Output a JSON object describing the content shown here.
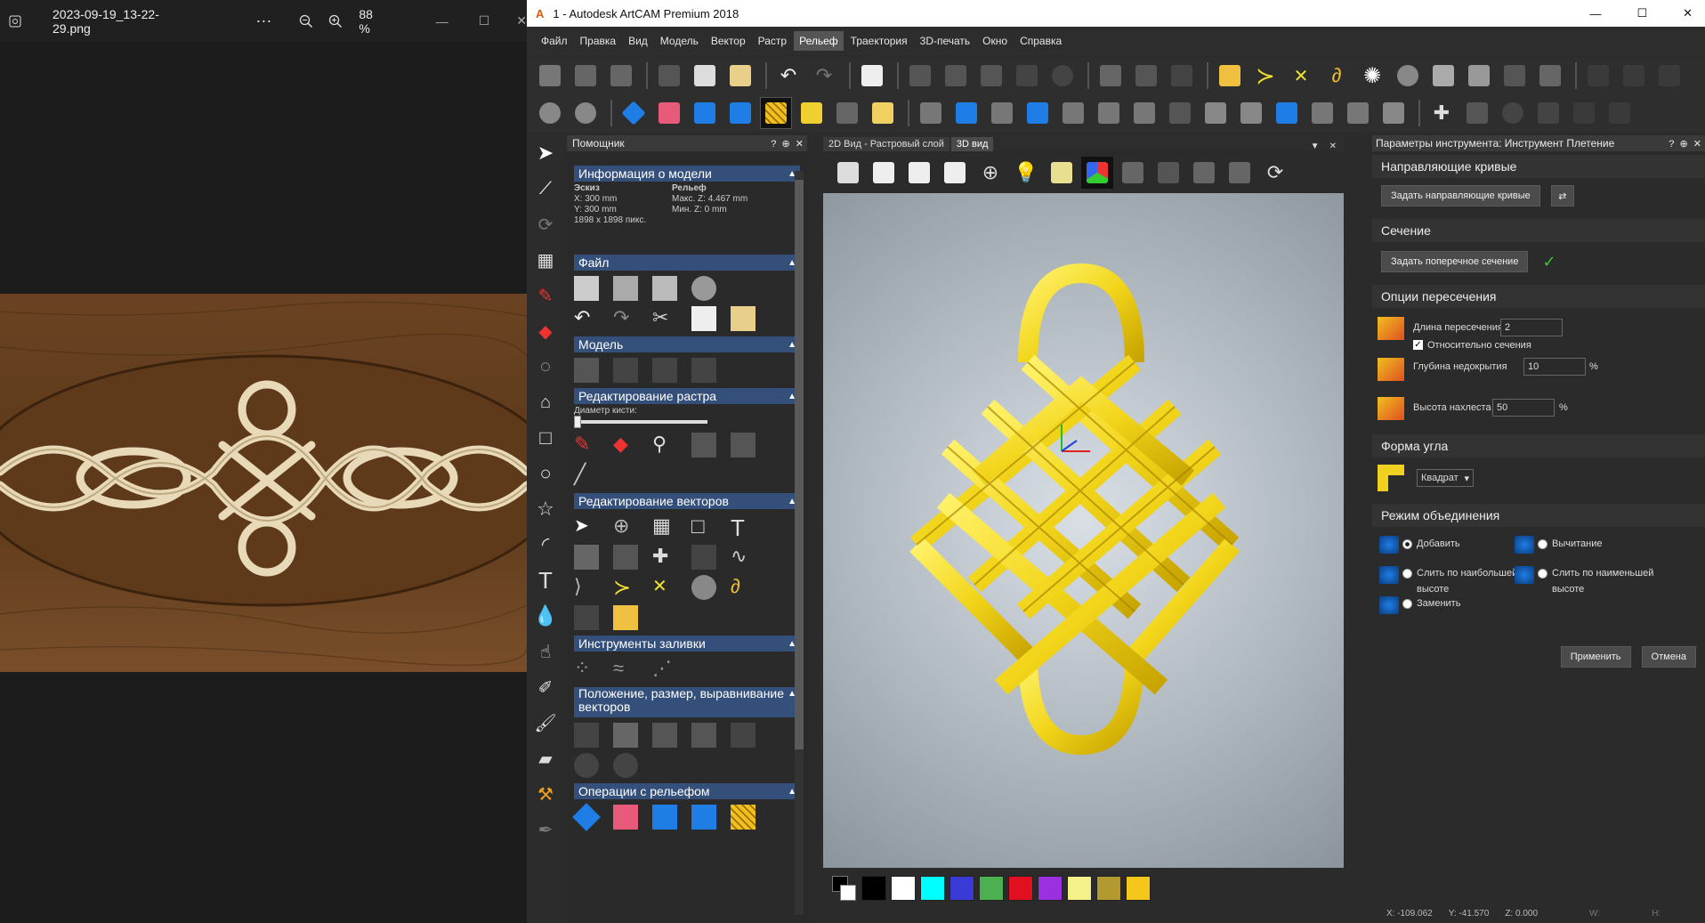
{
  "viewer": {
    "filename": "2023-09-19_13-22-29.png",
    "more": "···",
    "zoom": "88 %"
  },
  "app": {
    "title": "1 - Autodesk ArtCAM Premium 2018"
  },
  "menu": [
    "Файл",
    "Правка",
    "Вид",
    "Модель",
    "Вектор",
    "Растр",
    "Рельеф",
    "Траектория",
    "3D-печать",
    "Окно",
    "Справка"
  ],
  "wizard": {
    "title": "Помощник",
    "model_info": {
      "header": "Информация о модели",
      "sketch_label": "Эскиз",
      "x": "X: 300 mm",
      "y": "Y: 300 mm",
      "pixels": "1898 x 1898 пикс.",
      "relief_label": "Рельеф",
      "max_z": "Макс. Z: 4.467 mm",
      "min_z": "Мин. Z: 0 mm"
    },
    "file_header": "Файл",
    "model_header": "Модель",
    "raster_header": "Редактирование растра",
    "brush_label": "Диаметр кисти:",
    "vector_header": "Редактирование векторов",
    "fill_header": "Инструменты заливки",
    "position_header": "Положение, размер, выравнивание векторов",
    "relief_header": "Операции с рельефом"
  },
  "tabs": {
    "tab2d": "2D Вид - Растровый слой",
    "tab3d": "3D вид"
  },
  "palette": [
    "#000000",
    "#ffffff",
    "#00ffff",
    "#3a3ad6",
    "#4caf50",
    "#e01020",
    "#9b30e0",
    "#f5f18a",
    "#b29a30",
    "#f5c71a"
  ],
  "toolparams": {
    "title": "Параметры инструмента: Инструмент Плетение",
    "guides_header": "Направляющие кривые",
    "guides_button": "Задать направляющие кривые",
    "section_header": "Сечение",
    "section_button": "Задать поперечное сечение",
    "intersect_header": "Опции пересечения",
    "intersect_len_label": "Длина пересечения",
    "intersect_len_value": "2",
    "relative_label": "Относительно сечения",
    "undercover_label": "Глубина недокрытия",
    "undercover_value": "10",
    "overlap_label": "Высота нахлеста",
    "overlap_value": "50",
    "percent": "%",
    "corner_header": "Форма угла",
    "corner_value": "Квадрат",
    "merge_header": "Режим объединения",
    "add": "Добавить",
    "subtract": "Вычитание",
    "merge_high_1": "Слить по наибольшей",
    "merge_high_2": "высоте",
    "merge_low_1": "Слить по наименьшей",
    "merge_low_2": "высоте",
    "replace": "Заменить",
    "apply": "Применить",
    "cancel": "Отмена"
  },
  "status": {
    "x": "X: -109.062",
    "y": "Y: -41.570",
    "z": "Z: 0.000",
    "w": "W:",
    "h": "H:"
  }
}
